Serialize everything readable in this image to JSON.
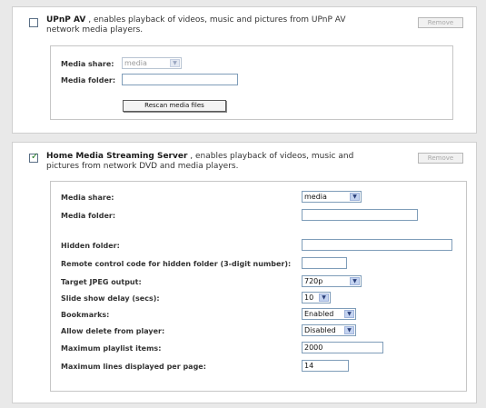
{
  "upnp": {
    "checked": false,
    "title": "UPnP AV",
    "description_line1": " , enables playback of videos, music and pictures from UPnP AV",
    "description_line2": "network media players.",
    "remove_label": "Remove",
    "media_share_label": "Media share:",
    "media_share_value": "media",
    "media_folder_label": "Media folder:",
    "media_folder_value": "",
    "rescan_label": "Rescan media files"
  },
  "hms": {
    "checked": true,
    "title": "Home Media Streaming Server",
    "description_line1": " , enables playback of videos, music and",
    "description_line2": "pictures from network DVD and media players.",
    "remove_label": "Remove",
    "fields": {
      "media_share": {
        "label": "Media share:",
        "value": "media"
      },
      "media_folder": {
        "label": "Media folder:",
        "value": ""
      },
      "hidden_folder": {
        "label": "Hidden folder:",
        "value": ""
      },
      "remote_code": {
        "label": "Remote control code for hidden folder (3-digit number):",
        "value": ""
      },
      "jpeg_output": {
        "label": "Target JPEG output:",
        "value": "720p"
      },
      "slideshow_delay": {
        "label": "Slide show delay (secs):",
        "value": "10"
      },
      "bookmarks": {
        "label": "Bookmarks:",
        "value": "Enabled"
      },
      "allow_delete": {
        "label": "Allow delete from player:",
        "value": "Disabled"
      },
      "max_playlist": {
        "label": "Maximum playlist items:",
        "value": "2000"
      },
      "max_lines": {
        "label": "Maximum lines displayed per page:",
        "value": "14"
      }
    }
  },
  "icons": {
    "checkbox_checked": "check-icon",
    "dropdown": "chevron-down-icon"
  },
  "colors": {
    "background": "#e9e9e9",
    "panel": "#ffffff",
    "input_border": "#7f9db9",
    "dropdown_arrow_bg": "#c4d3f0",
    "check_green": "#1f7a22"
  }
}
